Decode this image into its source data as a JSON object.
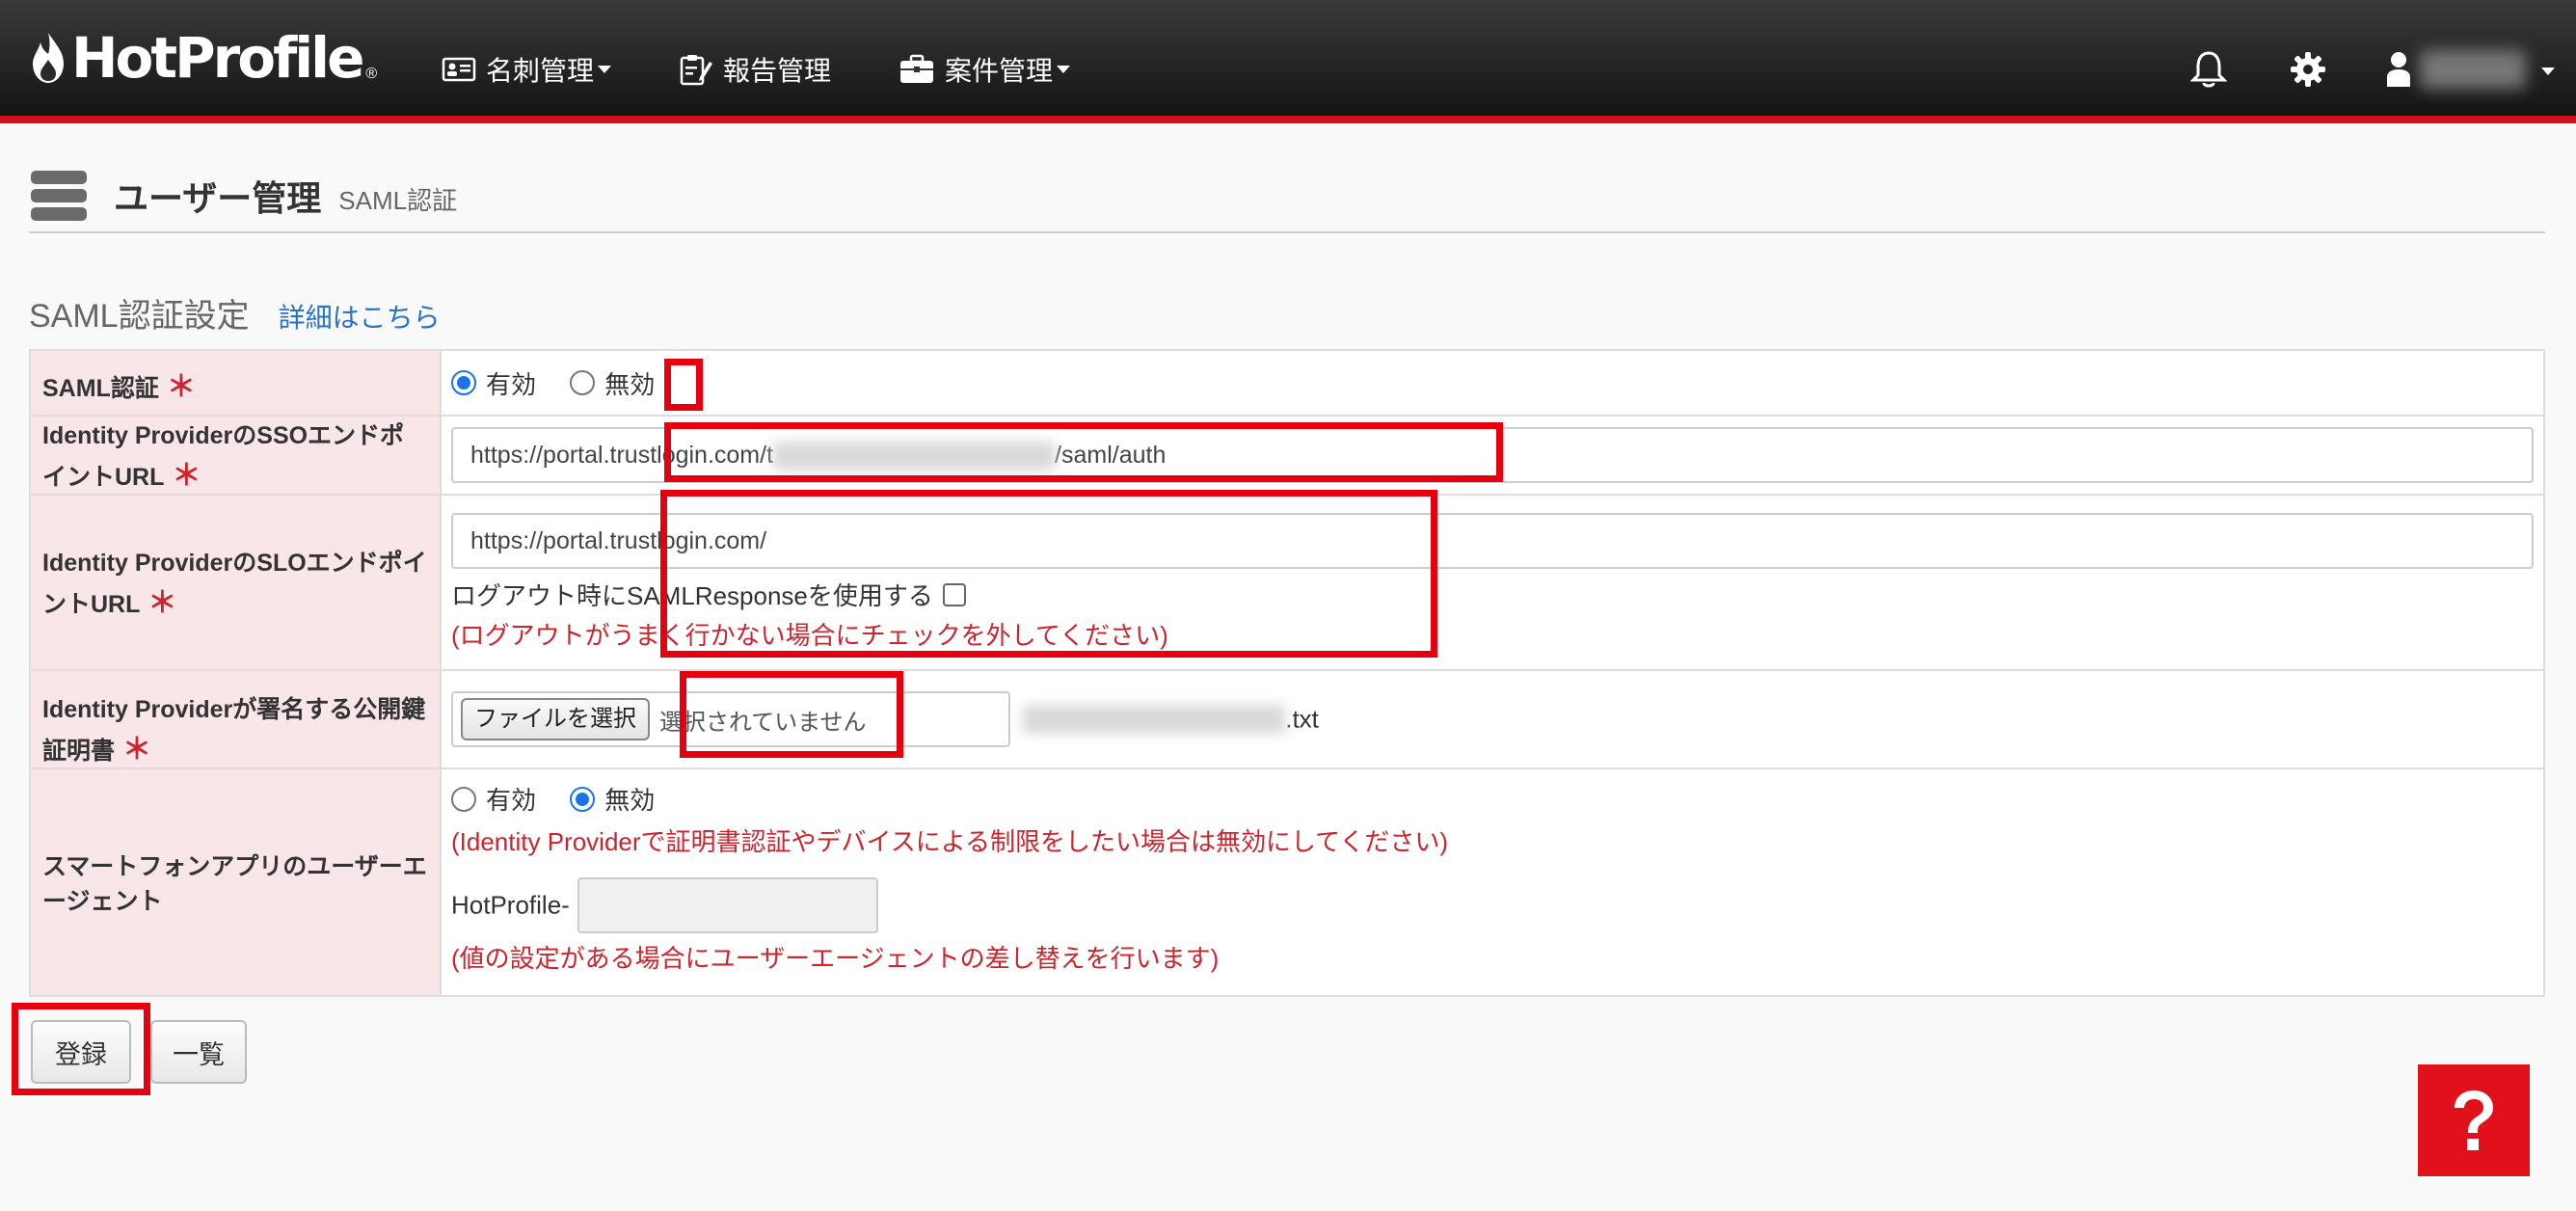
{
  "app": {
    "logo_text": "HotProfile",
    "logo_reg": "®"
  },
  "nav": {
    "items": [
      {
        "label": "名刺管理",
        "has_caret": true,
        "icon": "business-card-icon"
      },
      {
        "label": "報告管理",
        "has_caret": false,
        "icon": "report-icon"
      },
      {
        "label": "案件管理",
        "has_caret": true,
        "icon": "briefcase-icon"
      }
    ],
    "right_icons": [
      "bell-icon",
      "gear-icon",
      "user-icon"
    ]
  },
  "page": {
    "title": "ユーザー管理",
    "subtitle": "SAML認証"
  },
  "section": {
    "title": "SAML認証設定",
    "detail_link": "詳細はこちら"
  },
  "form": {
    "saml": {
      "label": "SAML認証",
      "required_mark": "＊",
      "options": [
        "有効",
        "無効"
      ],
      "selected": "有効"
    },
    "sso_url": {
      "label": "Identity ProviderのSSOエンドポイントURL",
      "required_mark": "＊",
      "value_prefix": "https://portal.trustlogin.com/t",
      "value_suffix": "/saml/auth"
    },
    "slo_url": {
      "label": "Identity ProviderのSLOエンドポイントURL",
      "required_mark": "＊",
      "value": "https://portal.trustlogin.com/",
      "checkbox_label": "ログアウト時にSAMLResponseを使用する",
      "checked": false,
      "note": "(ログアウトがうまく行かない場合にチェックを外してください)"
    },
    "certificate": {
      "label": "Identity Providerが署名する公開鍵証明書",
      "required_mark": "＊",
      "button_label": "ファイルを選択",
      "status": "選択されていません",
      "file_suffix": ".txt"
    },
    "user_agent": {
      "label": "スマートフォンアプリのユーザーエージェント",
      "options": [
        "有効",
        "無効"
      ],
      "selected": "無効",
      "note1": "(Identity Providerで証明書認証やデバイスによる制限をしたい場合は無効にしてください)",
      "prefix": "HotProfile-",
      "value": "",
      "note2": "(値の設定がある場合にユーザーエージェントの差し替えを行います)"
    }
  },
  "buttons": {
    "register": "登録",
    "list": "一覧",
    "help": "?"
  },
  "colors": {
    "accent_red": "#e6000f",
    "navbar_bottom": "#d4101b",
    "label_bg": "#f9e6e8",
    "link": "#2a72c4",
    "warn": "#c8252c"
  }
}
